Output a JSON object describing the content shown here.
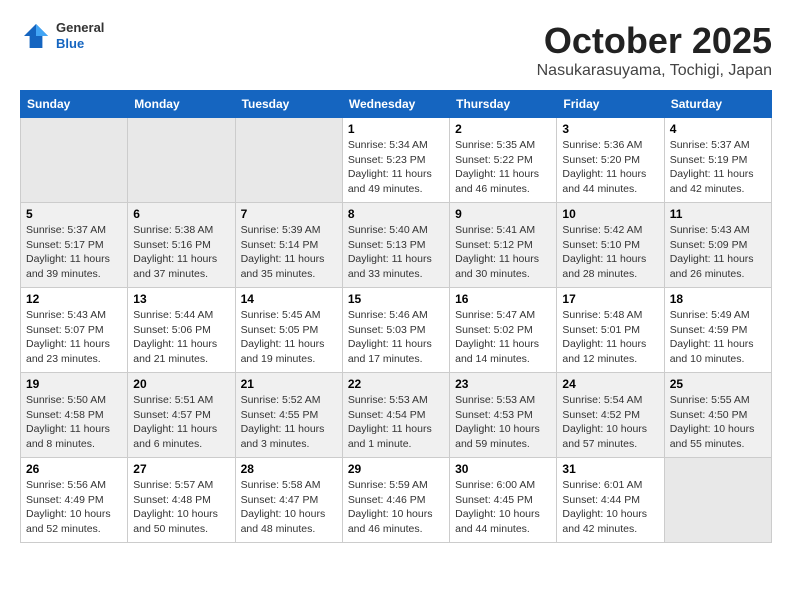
{
  "header": {
    "logo": {
      "general": "General",
      "blue": "Blue"
    },
    "title": "October 2025",
    "location": "Nasukarasuyama, Tochigi, Japan"
  },
  "weekdays": [
    "Sunday",
    "Monday",
    "Tuesday",
    "Wednesday",
    "Thursday",
    "Friday",
    "Saturday"
  ],
  "weeks": [
    [
      {
        "day": "",
        "info": ""
      },
      {
        "day": "",
        "info": ""
      },
      {
        "day": "",
        "info": ""
      },
      {
        "day": "1",
        "info": "Sunrise: 5:34 AM\nSunset: 5:23 PM\nDaylight: 11 hours\nand 49 minutes."
      },
      {
        "day": "2",
        "info": "Sunrise: 5:35 AM\nSunset: 5:22 PM\nDaylight: 11 hours\nand 46 minutes."
      },
      {
        "day": "3",
        "info": "Sunrise: 5:36 AM\nSunset: 5:20 PM\nDaylight: 11 hours\nand 44 minutes."
      },
      {
        "day": "4",
        "info": "Sunrise: 5:37 AM\nSunset: 5:19 PM\nDaylight: 11 hours\nand 42 minutes."
      }
    ],
    [
      {
        "day": "5",
        "info": "Sunrise: 5:37 AM\nSunset: 5:17 PM\nDaylight: 11 hours\nand 39 minutes."
      },
      {
        "day": "6",
        "info": "Sunrise: 5:38 AM\nSunset: 5:16 PM\nDaylight: 11 hours\nand 37 minutes."
      },
      {
        "day": "7",
        "info": "Sunrise: 5:39 AM\nSunset: 5:14 PM\nDaylight: 11 hours\nand 35 minutes."
      },
      {
        "day": "8",
        "info": "Sunrise: 5:40 AM\nSunset: 5:13 PM\nDaylight: 11 hours\nand 33 minutes."
      },
      {
        "day": "9",
        "info": "Sunrise: 5:41 AM\nSunset: 5:12 PM\nDaylight: 11 hours\nand 30 minutes."
      },
      {
        "day": "10",
        "info": "Sunrise: 5:42 AM\nSunset: 5:10 PM\nDaylight: 11 hours\nand 28 minutes."
      },
      {
        "day": "11",
        "info": "Sunrise: 5:43 AM\nSunset: 5:09 PM\nDaylight: 11 hours\nand 26 minutes."
      }
    ],
    [
      {
        "day": "12",
        "info": "Sunrise: 5:43 AM\nSunset: 5:07 PM\nDaylight: 11 hours\nand 23 minutes."
      },
      {
        "day": "13",
        "info": "Sunrise: 5:44 AM\nSunset: 5:06 PM\nDaylight: 11 hours\nand 21 minutes."
      },
      {
        "day": "14",
        "info": "Sunrise: 5:45 AM\nSunset: 5:05 PM\nDaylight: 11 hours\nand 19 minutes."
      },
      {
        "day": "15",
        "info": "Sunrise: 5:46 AM\nSunset: 5:03 PM\nDaylight: 11 hours\nand 17 minutes."
      },
      {
        "day": "16",
        "info": "Sunrise: 5:47 AM\nSunset: 5:02 PM\nDaylight: 11 hours\nand 14 minutes."
      },
      {
        "day": "17",
        "info": "Sunrise: 5:48 AM\nSunset: 5:01 PM\nDaylight: 11 hours\nand 12 minutes."
      },
      {
        "day": "18",
        "info": "Sunrise: 5:49 AM\nSunset: 4:59 PM\nDaylight: 11 hours\nand 10 minutes."
      }
    ],
    [
      {
        "day": "19",
        "info": "Sunrise: 5:50 AM\nSunset: 4:58 PM\nDaylight: 11 hours\nand 8 minutes."
      },
      {
        "day": "20",
        "info": "Sunrise: 5:51 AM\nSunset: 4:57 PM\nDaylight: 11 hours\nand 6 minutes."
      },
      {
        "day": "21",
        "info": "Sunrise: 5:52 AM\nSunset: 4:55 PM\nDaylight: 11 hours\nand 3 minutes."
      },
      {
        "day": "22",
        "info": "Sunrise: 5:53 AM\nSunset: 4:54 PM\nDaylight: 11 hours\nand 1 minute."
      },
      {
        "day": "23",
        "info": "Sunrise: 5:53 AM\nSunset: 4:53 PM\nDaylight: 10 hours\nand 59 minutes."
      },
      {
        "day": "24",
        "info": "Sunrise: 5:54 AM\nSunset: 4:52 PM\nDaylight: 10 hours\nand 57 minutes."
      },
      {
        "day": "25",
        "info": "Sunrise: 5:55 AM\nSunset: 4:50 PM\nDaylight: 10 hours\nand 55 minutes."
      }
    ],
    [
      {
        "day": "26",
        "info": "Sunrise: 5:56 AM\nSunset: 4:49 PM\nDaylight: 10 hours\nand 52 minutes."
      },
      {
        "day": "27",
        "info": "Sunrise: 5:57 AM\nSunset: 4:48 PM\nDaylight: 10 hours\nand 50 minutes."
      },
      {
        "day": "28",
        "info": "Sunrise: 5:58 AM\nSunset: 4:47 PM\nDaylight: 10 hours\nand 48 minutes."
      },
      {
        "day": "29",
        "info": "Sunrise: 5:59 AM\nSunset: 4:46 PM\nDaylight: 10 hours\nand 46 minutes."
      },
      {
        "day": "30",
        "info": "Sunrise: 6:00 AM\nSunset: 4:45 PM\nDaylight: 10 hours\nand 44 minutes."
      },
      {
        "day": "31",
        "info": "Sunrise: 6:01 AM\nSunset: 4:44 PM\nDaylight: 10 hours\nand 42 minutes."
      },
      {
        "day": "",
        "info": ""
      }
    ]
  ]
}
